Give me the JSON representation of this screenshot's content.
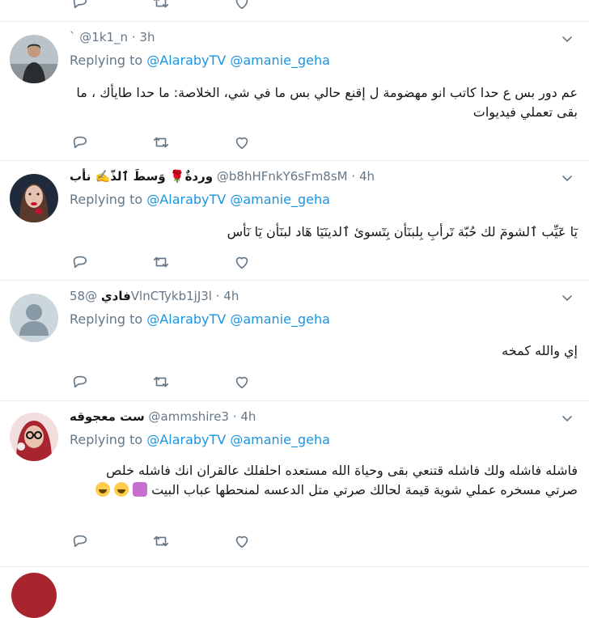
{
  "colors": {
    "link": "#1b95e0",
    "muted": "#657786",
    "divider": "#e6ecf0"
  },
  "tweets": [
    {
      "name": "",
      "handle": "@1k1_n",
      "sep": "·",
      "time": "3h",
      "reply_prefix": "Replying to",
      "mention1": "@AlarabyTV",
      "mention2": "@amanie_geha",
      "text": "عم دور بس ع حدا كاتب انو مهضومة ل إقنع حالي بس ما في شي، الخلاصة: ما حدا طايأك ، ما بقى تعملي فيديوات",
      "avatar": "man-in-dark-jacket"
    },
    {
      "name": "وردةٌ🌹 وَسطَ ٱلذّ✍️ نأب",
      "handle": "@b8hHFnkY6sFm8sM",
      "sep": "·",
      "time": "4h",
      "reply_prefix": "Replying to",
      "mention1": "@AlarabyTV",
      "mention2": "@amanie_geha",
      "text": "يٓا عٓيِّب ٱلشومٓ لك حُبّة تٓرأبِ بِلبنٓأن بِتٓسوئ ٱلدينٓيٓا هٓاد لبنٓأن يٓا نٓأس",
      "avatar": "woman-red-lips"
    },
    {
      "name": "فادي",
      "handle": "@58VlnCTykb1jJ3l",
      "sep": "·",
      "time": "4h",
      "reply_prefix": "Replying to",
      "mention1": "@AlarabyTV",
      "mention2": "@amanie_geha",
      "text": "إي والله كمخه",
      "avatar": "default-profile"
    },
    {
      "name": "ست معجوقه",
      "handle": "@ammshire3",
      "sep": "·",
      "time": "4h",
      "reply_prefix": "Replying to",
      "mention1": "@AlarabyTV",
      "mention2": "@amanie_geha",
      "text": "فاشله فاشله ولك فاشله قتنعي بقى وحياة الله مستعده احلفلك عالقران انك فاشله خلص صرتي مسخره عملي شوية قيمة لحالك صرتي متل الدعسه لمنحطها عباب البيت",
      "avatar": "woman-with-glasses"
    }
  ],
  "icons": {
    "reply": "reply-icon",
    "retweet": "retweet-icon",
    "like": "heart-icon",
    "more": "chevron-down-icon"
  }
}
